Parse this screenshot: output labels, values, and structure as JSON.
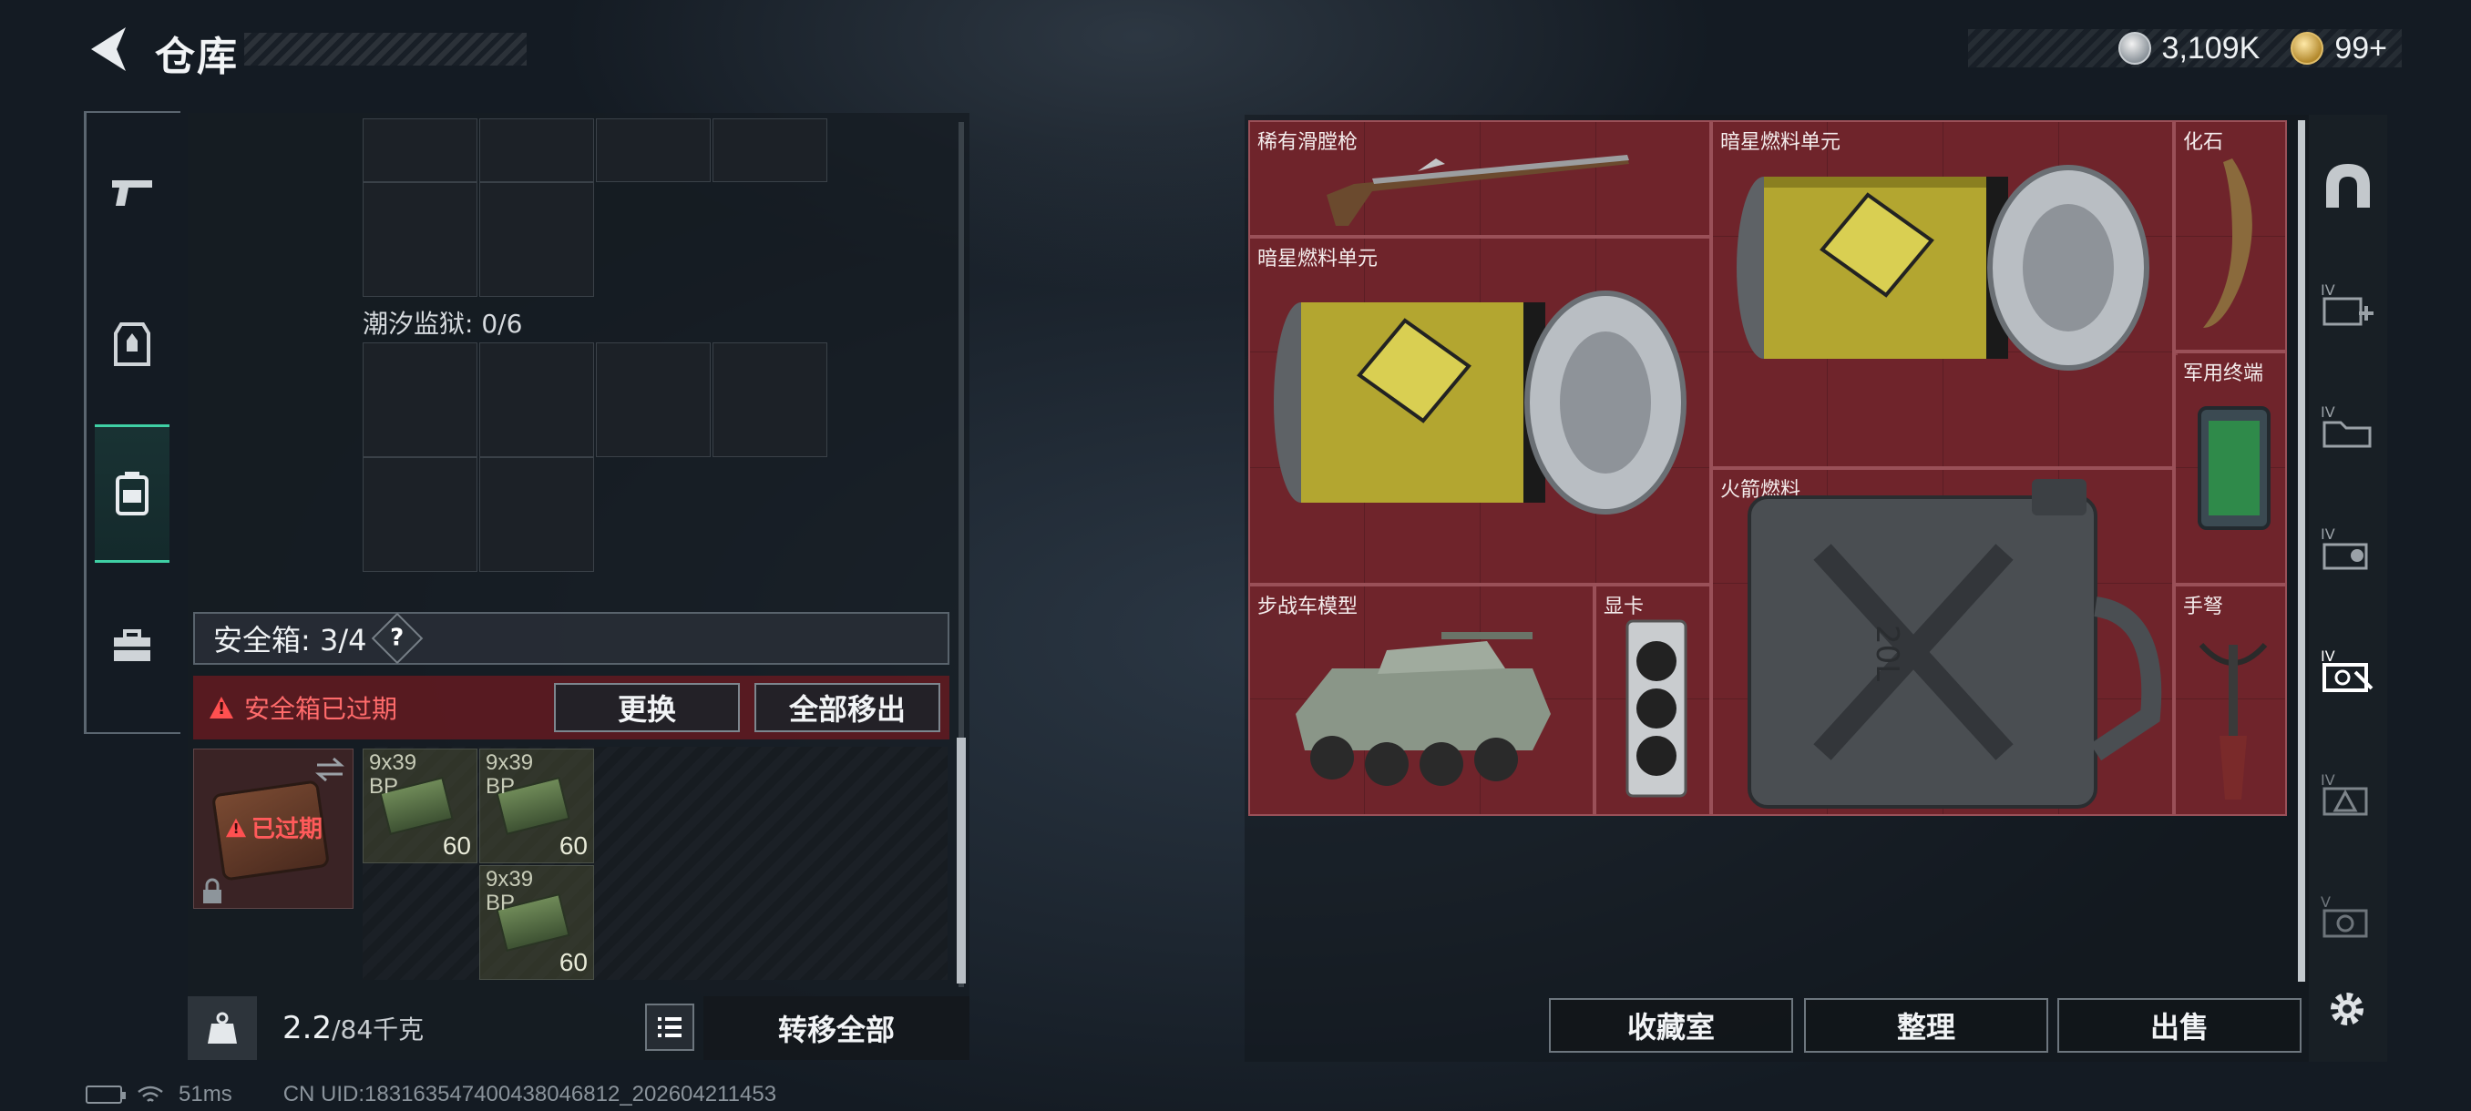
{
  "header": {
    "title": "仓库",
    "currency": {
      "silver": "3,109K",
      "gold": "99+"
    }
  },
  "backpack": {
    "region_label": "潮汐监狱: 0/6",
    "safe_box": {
      "label": "安全箱: 3/4",
      "help": "?",
      "expired_msg": "安全箱已过期",
      "replace_label": "更换",
      "move_all_label": "全部移出",
      "box_expired": "已过期"
    },
    "ammo": [
      {
        "caliber": "9x39",
        "type": "BP",
        "count": "60"
      },
      {
        "caliber": "9x39",
        "type": "BP",
        "count": "60"
      },
      {
        "caliber": "9x39",
        "type": "BP",
        "count": "60"
      }
    ],
    "weight": {
      "current": "2.2",
      "max": "/84千克"
    },
    "transfer_all_label": "转移全部"
  },
  "stash": {
    "items": [
      {
        "name": "稀有滑膛枪"
      },
      {
        "name": "暗星燃料单元"
      },
      {
        "name": "暗星燃料单元"
      },
      {
        "name": "化石"
      },
      {
        "name": "军用终端"
      },
      {
        "name": "火箭燃料"
      },
      {
        "name": "步战车模型"
      },
      {
        "name": "显卡"
      },
      {
        "name": "手弩"
      }
    ],
    "jerry_can_text": "20L"
  },
  "bottom_buttons": {
    "collection": "收藏室",
    "organize": "整理",
    "sell": "出售"
  },
  "side_tab_levels": [
    "IV",
    "IV",
    "IV",
    "IV",
    "IV",
    "V"
  ],
  "status": {
    "ping": "51ms",
    "uid": "CN UID:1831635474004380​46812_202604211453"
  },
  "colors": {
    "accent_green": "#3fd0a4",
    "expired_red": "#ff5050",
    "stash_red": "#6a2329"
  }
}
